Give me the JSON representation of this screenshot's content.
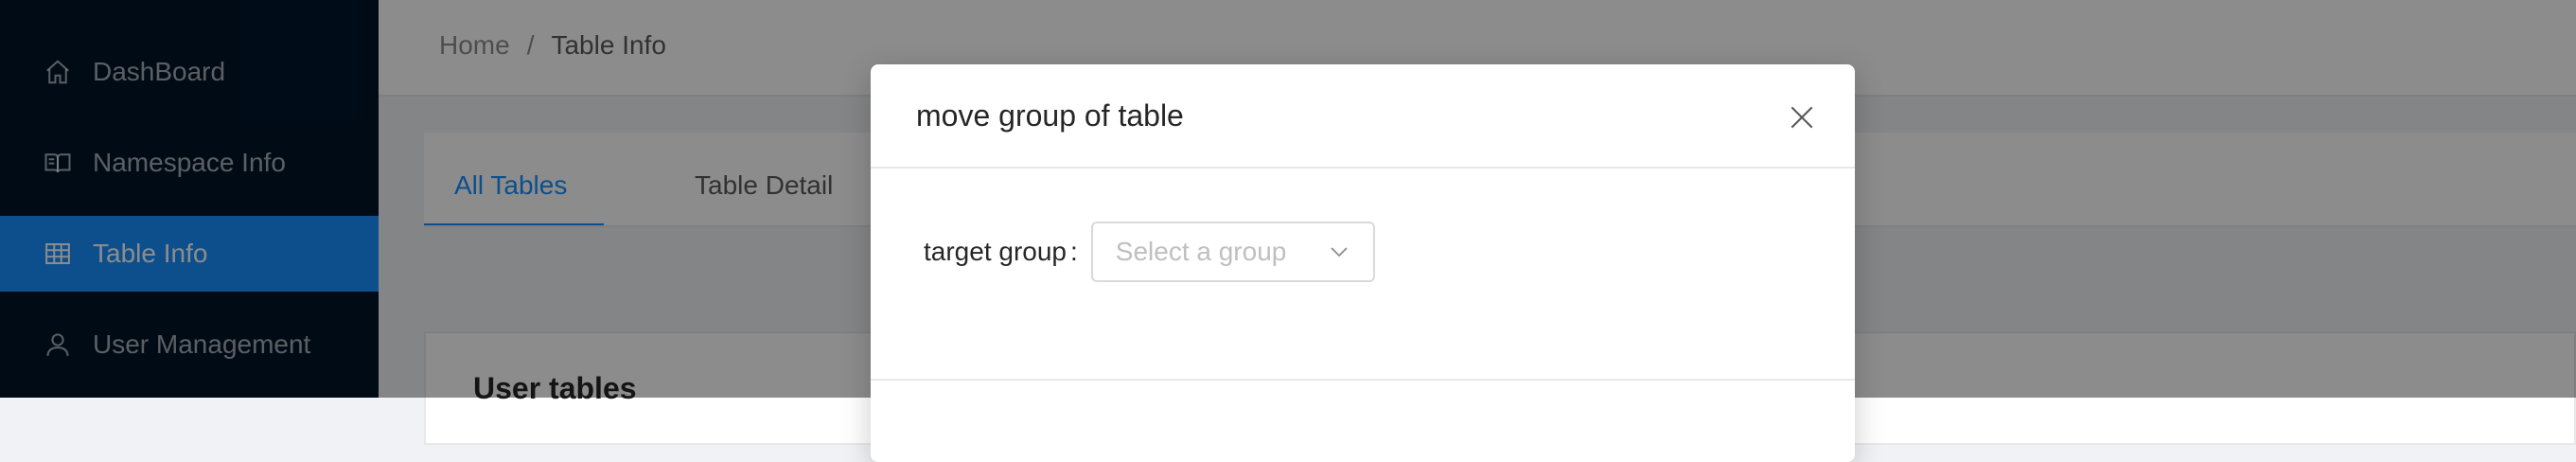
{
  "sidebar": {
    "items": [
      {
        "label": "DashBoard",
        "icon": "home-icon",
        "active": false
      },
      {
        "label": "Namespace Info",
        "icon": "book-icon",
        "active": false
      },
      {
        "label": "Table Info",
        "icon": "table-icon",
        "active": true
      },
      {
        "label": "User Management",
        "icon": "user-icon",
        "active": false
      }
    ]
  },
  "header": {
    "breadcrumb": {
      "home": "Home",
      "separator": "/",
      "current": "Table Info"
    }
  },
  "tabs": [
    {
      "label": "All Tables",
      "active": true
    },
    {
      "label": "Table Detail",
      "active": false
    }
  ],
  "card": {
    "title": "User tables"
  },
  "modal": {
    "title": "move group of table",
    "form": {
      "label": "target group",
      "colon": ":",
      "select_placeholder": "Select a group"
    }
  },
  "colors": {
    "sidebar_bg": "#001529",
    "accent": "#1890ff",
    "mask": "rgba(0,0,0,0.45)"
  }
}
